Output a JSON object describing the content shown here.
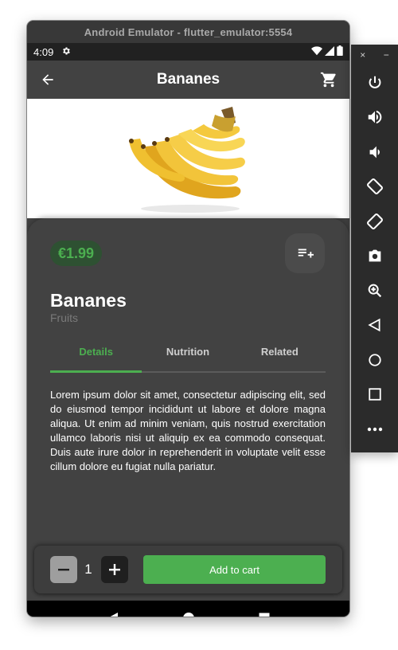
{
  "window": {
    "title": "Android Emulator - flutter_emulator:5554"
  },
  "status_bar": {
    "time": "4:09",
    "icons": [
      "settings-icon",
      "wifi-icon",
      "signal-icon",
      "battery-icon"
    ]
  },
  "app_bar": {
    "title": "Bananes",
    "back_icon": "arrow-back-icon",
    "cart_icon": "shopping-cart-icon"
  },
  "product": {
    "image": "banana-bunch",
    "price": "€1.99",
    "name": "Bananes",
    "category": "Fruits",
    "description": "Lorem ipsum dolor sit amet, consectetur adipiscing elit, sed do eiusmod tempor incididunt ut labore et dolore magna aliqua. Ut enim ad minim veniam, quis nostrud exercitation ullamco laboris nisi ut aliquip ex ea commodo consequat. Duis aute irure dolor in reprehenderit in voluptate velit esse cillum dolore eu fugiat nulla pariatur."
  },
  "tabs": [
    {
      "label": "Details",
      "active": true
    },
    {
      "label": "Nutrition",
      "active": false
    },
    {
      "label": "Related",
      "active": false
    }
  ],
  "cart": {
    "quantity": "1",
    "add_label": "Add to cart"
  },
  "nav_bar": {
    "icons": [
      "nav-back-icon",
      "nav-home-icon",
      "nav-recents-icon"
    ]
  },
  "emulator_toolbar": {
    "top": {
      "close": "×",
      "minimize": "−"
    },
    "buttons": [
      "power-icon",
      "volume-up-icon",
      "volume-down-icon",
      "rotate-left-icon",
      "rotate-right-icon",
      "camera-icon",
      "zoom-icon",
      "back-icon",
      "home-icon",
      "overview-icon",
      "more-icon"
    ]
  },
  "colors": {
    "accent": "#4caf50",
    "surface": "#424242",
    "price_badge_bg": "#2e5132"
  }
}
